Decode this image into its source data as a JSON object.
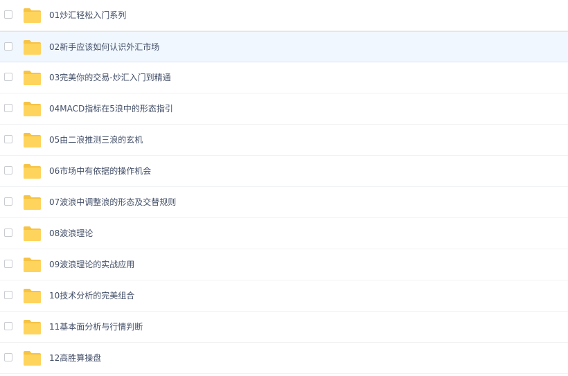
{
  "file_list": {
    "selected_index": 1,
    "items": [
      {
        "name": "01炒汇轻松入门系列",
        "icon": "folder-icon"
      },
      {
        "name": "02新手应该如何认识外汇市场",
        "icon": "folder-icon"
      },
      {
        "name": "03完美你的交易-炒汇入门到精通",
        "icon": "folder-icon"
      },
      {
        "name": "04MACD指标在5浪中的形态指引",
        "icon": "folder-icon"
      },
      {
        "name": "05由二浪推测三浪的玄机",
        "icon": "folder-icon"
      },
      {
        "name": "06市场中有依据的操作机会",
        "icon": "folder-icon"
      },
      {
        "name": "07波浪中调整浪的形态及交替规则",
        "icon": "folder-icon"
      },
      {
        "name": "08波浪理论",
        "icon": "folder-icon"
      },
      {
        "name": "09波浪理论的实战应用",
        "icon": "folder-icon"
      },
      {
        "name": "10技术分析的完美组合",
        "icon": "folder-icon"
      },
      {
        "name": "11基本面分析与行情判断",
        "icon": "folder-icon"
      },
      {
        "name": "12高胜算操盘",
        "icon": "folder-icon"
      }
    ]
  },
  "colors": {
    "folder_body": "#ffd45c",
    "folder_tab": "#f6c343",
    "selected_row_bg": "#f0f7fe",
    "text": "#424e67"
  }
}
